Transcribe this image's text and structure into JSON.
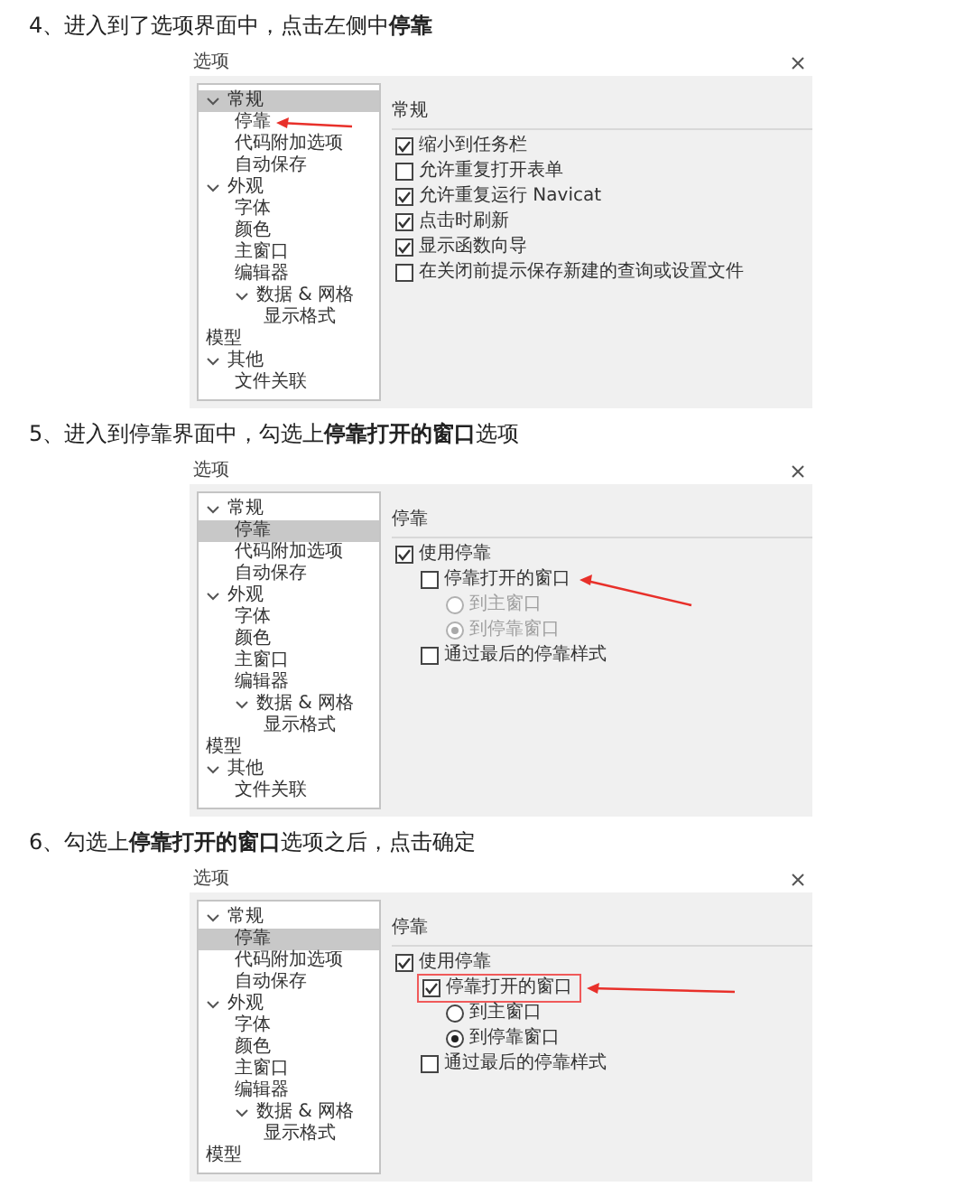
{
  "sections": [
    {
      "heading": "4、进入到了选项界面中，点击左侧中**停靠**",
      "dialog": {
        "title": "选项",
        "group_title": "常规",
        "tree": [
          {
            "label": "常规",
            "selected": true,
            "expanded": true,
            "arrow": false,
            "children": [
              {
                "label": "停靠",
                "selected": false,
                "arrow": true
              },
              {
                "label": "代码附加选项",
                "selected": false,
                "arrow": false
              },
              {
                "label": "自动保存",
                "selected": false,
                "arrow": false
              }
            ]
          },
          {
            "label": "外观",
            "selected": false,
            "expanded": true,
            "arrow": false,
            "children": [
              {
                "label": "字体",
                "selected": false,
                "arrow": false
              },
              {
                "label": "颜色",
                "selected": false,
                "arrow": false
              },
              {
                "label": "主窗口",
                "selected": false,
                "arrow": false
              },
              {
                "label": "编辑器",
                "selected": false,
                "arrow": false
              },
              {
                "label": "数据 & 网格",
                "selected": false,
                "expanded": true,
                "arrow": false,
                "children": [
                  {
                    "label": "显示格式",
                    "selected": false,
                    "arrow": false
                  }
                ]
              }
            ]
          },
          {
            "label": "模型",
            "selected": false,
            "arrow": false
          },
          {
            "label": "其他",
            "selected": false,
            "expanded": true,
            "arrow": false,
            "children": [
              {
                "label": "文件关联",
                "selected": false,
                "arrow": false
              }
            ]
          }
        ],
        "options": [
          {
            "kind": "checkbox",
            "label": "缩小到任务栏",
            "checked": true,
            "disabled": false,
            "arrow": false,
            "boxed": false
          },
          {
            "kind": "checkbox",
            "label": "允许重复打开表单",
            "checked": false,
            "disabled": false,
            "arrow": false,
            "boxed": false
          },
          {
            "kind": "checkbox",
            "label": "允许重复运行 Navicat",
            "checked": true,
            "disabled": false,
            "arrow": false,
            "boxed": false
          },
          {
            "kind": "checkbox",
            "label": "点击时刷新",
            "checked": true,
            "disabled": false,
            "arrow": false,
            "boxed": false
          },
          {
            "kind": "checkbox",
            "label": "显示函数向导",
            "checked": true,
            "disabled": false,
            "arrow": false,
            "boxed": false
          },
          {
            "kind": "checkbox",
            "label": "在关闭前提示保存新建的查询或设置文件",
            "checked": false,
            "disabled": false,
            "arrow": false,
            "boxed": false
          }
        ]
      }
    },
    {
      "heading": "5、进入到停靠界面中，勾选上**停靠打开的窗口**选项",
      "dialog": {
        "title": "选项",
        "group_title": "停靠",
        "tree": [
          {
            "label": "常规",
            "selected": false,
            "expanded": true,
            "arrow": false,
            "children": [
              {
                "label": "停靠",
                "selected": true,
                "arrow": false
              },
              {
                "label": "代码附加选项",
                "selected": false,
                "arrow": false
              },
              {
                "label": "自动保存",
                "selected": false,
                "arrow": false
              }
            ]
          },
          {
            "label": "外观",
            "selected": false,
            "expanded": true,
            "arrow": false,
            "children": [
              {
                "label": "字体",
                "selected": false,
                "arrow": false
              },
              {
                "label": "颜色",
                "selected": false,
                "arrow": false
              },
              {
                "label": "主窗口",
                "selected": false,
                "arrow": false
              },
              {
                "label": "编辑器",
                "selected": false,
                "arrow": false
              },
              {
                "label": "数据 & 网格",
                "selected": false,
                "expanded": true,
                "arrow": false,
                "children": [
                  {
                    "label": "显示格式",
                    "selected": false,
                    "arrow": false
                  }
                ]
              }
            ]
          },
          {
            "label": "模型",
            "selected": false,
            "arrow": false
          },
          {
            "label": "其他",
            "selected": false,
            "expanded": true,
            "arrow": false,
            "children": [
              {
                "label": "文件关联",
                "selected": false,
                "arrow": false
              }
            ]
          }
        ],
        "options": [
          {
            "kind": "checkbox",
            "label": "使用停靠",
            "checked": true,
            "disabled": false,
            "arrow": false,
            "boxed": false,
            "children": [
              {
                "kind": "checkbox",
                "label": "停靠打开的窗口",
                "checked": false,
                "disabled": false,
                "arrow": true,
                "boxed": false,
                "children": [
                  {
                    "kind": "radio",
                    "label": "到主窗口",
                    "checked": false,
                    "disabled": true,
                    "arrow": false,
                    "boxed": false
                  },
                  {
                    "kind": "radio",
                    "label": "到停靠窗口",
                    "checked": true,
                    "disabled": true,
                    "arrow": false,
                    "boxed": false
                  }
                ]
              },
              {
                "kind": "checkbox",
                "label": "通过最后的停靠样式",
                "checked": false,
                "disabled": false,
                "arrow": false,
                "boxed": false
              }
            ]
          }
        ]
      }
    },
    {
      "heading": "6、勾选上**停靠打开的窗口**选项之后，点击确定",
      "dialog": {
        "title": "选项",
        "group_title": "停靠",
        "tree": [
          {
            "label": "常规",
            "selected": false,
            "expanded": true,
            "arrow": false,
            "children": [
              {
                "label": "停靠",
                "selected": true,
                "arrow": false
              },
              {
                "label": "代码附加选项",
                "selected": false,
                "arrow": false
              },
              {
                "label": "自动保存",
                "selected": false,
                "arrow": false
              }
            ]
          },
          {
            "label": "外观",
            "selected": false,
            "expanded": true,
            "arrow": false,
            "children": [
              {
                "label": "字体",
                "selected": false,
                "arrow": false
              },
              {
                "label": "颜色",
                "selected": false,
                "arrow": false
              },
              {
                "label": "主窗口",
                "selected": false,
                "arrow": false
              },
              {
                "label": "编辑器",
                "selected": false,
                "arrow": false
              },
              {
                "label": "数据 & 网格",
                "selected": false,
                "expanded": true,
                "arrow": false,
                "children": [
                  {
                    "label": "显示格式",
                    "selected": false,
                    "arrow": false
                  }
                ]
              }
            ]
          },
          {
            "label": "模型",
            "selected": false,
            "arrow": false
          }
        ],
        "options": [
          {
            "kind": "checkbox",
            "label": "使用停靠",
            "checked": true,
            "disabled": false,
            "arrow": false,
            "boxed": false,
            "children": [
              {
                "kind": "checkbox",
                "label": "停靠打开的窗口",
                "checked": true,
                "disabled": false,
                "arrow": true,
                "boxed": true,
                "children": [
                  {
                    "kind": "radio",
                    "label": "到主窗口",
                    "checked": false,
                    "disabled": false,
                    "arrow": false,
                    "boxed": false
                  },
                  {
                    "kind": "radio",
                    "label": "到停靠窗口",
                    "checked": true,
                    "disabled": false,
                    "arrow": false,
                    "boxed": false
                  }
                ]
              },
              {
                "kind": "checkbox",
                "label": "通过最后的停靠样式",
                "checked": false,
                "disabled": false,
                "arrow": false,
                "boxed": false
              }
            ]
          }
        ]
      }
    }
  ]
}
